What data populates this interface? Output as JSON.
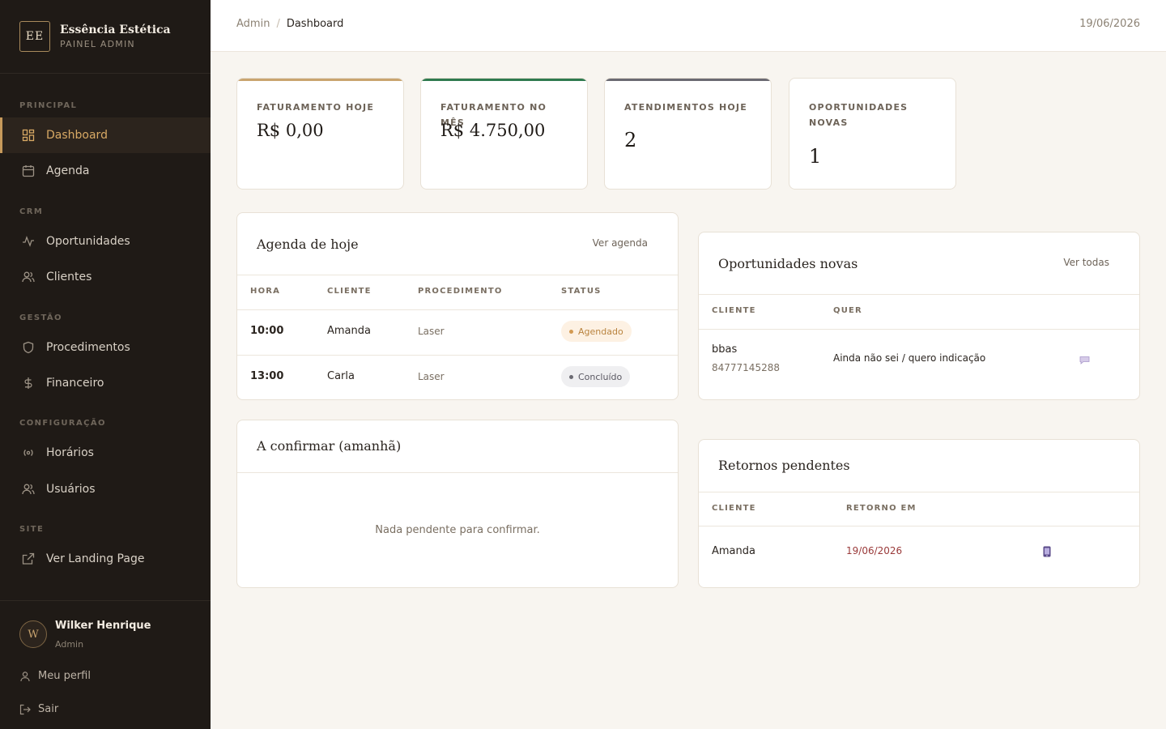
{
  "brand": {
    "logo": "EE",
    "name": "Essência Estética",
    "subtitle": "PAINEL ADMIN"
  },
  "sidebar": {
    "sections": [
      {
        "label": "PRINCIPAL"
      },
      {
        "label": "CRM"
      },
      {
        "label": "GESTÃO"
      },
      {
        "label": "CONFIGURAÇÃO"
      },
      {
        "label": "SITE"
      }
    ],
    "items": [
      {
        "label": "Dashboard",
        "icon": "grid-icon",
        "active": true
      },
      {
        "label": "Agenda",
        "icon": "calendar-icon"
      },
      {
        "label": "Oportunidades",
        "icon": "activity-icon"
      },
      {
        "label": "Clientes",
        "icon": "users-icon"
      },
      {
        "label": "Procedimentos",
        "icon": "shield-icon"
      },
      {
        "label": "Financeiro",
        "icon": "dollar-icon"
      },
      {
        "label": "Horários",
        "icon": "broadcast-icon"
      },
      {
        "label": "Usuários",
        "icon": "users-icon"
      },
      {
        "label": "Ver Landing Page",
        "icon": "external-link-icon"
      }
    ]
  },
  "user": {
    "initial": "W",
    "name": "Wilker Henrique",
    "role": "Admin",
    "profile_label": "Meu perfil",
    "logout_label": "Sair"
  },
  "header": {
    "breadcrumb_root": "Admin",
    "breadcrumb_sep": "/",
    "breadcrumb_current": "Dashboard",
    "date": "19/06/2026"
  },
  "stats": [
    {
      "label": "FATURAMENTO HOJE",
      "value": "R$ 0,00",
      "color": "#c9a46f"
    },
    {
      "label": "FATURAMENTO NO MÊS",
      "value": "R$ 4.750,00",
      "color": "#2f7a4f"
    },
    {
      "label": "ATENDIMENTOS HOJE",
      "value": "2",
      "color": "#6b6a72"
    },
    {
      "label": "OPORTUNIDADES NOVAS",
      "value": "1",
      "color": "#ffffff"
    }
  ],
  "agenda": {
    "title": "Agenda de hoje",
    "link": "Ver agenda",
    "columns": [
      "HORA",
      "CLIENTE",
      "PROCEDIMENTO",
      "STATUS"
    ],
    "rows": [
      {
        "hora": "10:00",
        "cliente": "Amanda",
        "procedimento": "Laser",
        "status": "Agendado"
      },
      {
        "hora": "13:00",
        "cliente": "Carla",
        "procedimento": "Laser",
        "status": "Concluído"
      }
    ]
  },
  "confirmar": {
    "title": "A confirmar (amanhã)",
    "empty": "Nada pendente para confirmar."
  },
  "oportunidades": {
    "title": "Oportunidades novas",
    "link": "Ver todas",
    "columns": [
      "CLIENTE",
      "QUER"
    ],
    "rows": [
      {
        "nome": "bbas",
        "telefone": "84777145288",
        "quer": "Ainda não sei / quero indicação",
        "icon": "chat-icon"
      }
    ]
  },
  "retornos": {
    "title": "Retornos pendentes",
    "columns": [
      "CLIENTE",
      "RETORNO EM"
    ],
    "rows": [
      {
        "cliente": "Amanda",
        "retorno": "19/06/2026",
        "icon": "phone-icon"
      }
    ]
  },
  "colors": {
    "accent": "#c79a5b",
    "sidebar": "#1f1a16",
    "return_date": "#9a3a3a",
    "badge_scheduled": "#fdf1e3",
    "badge_done": "#efeff1"
  }
}
